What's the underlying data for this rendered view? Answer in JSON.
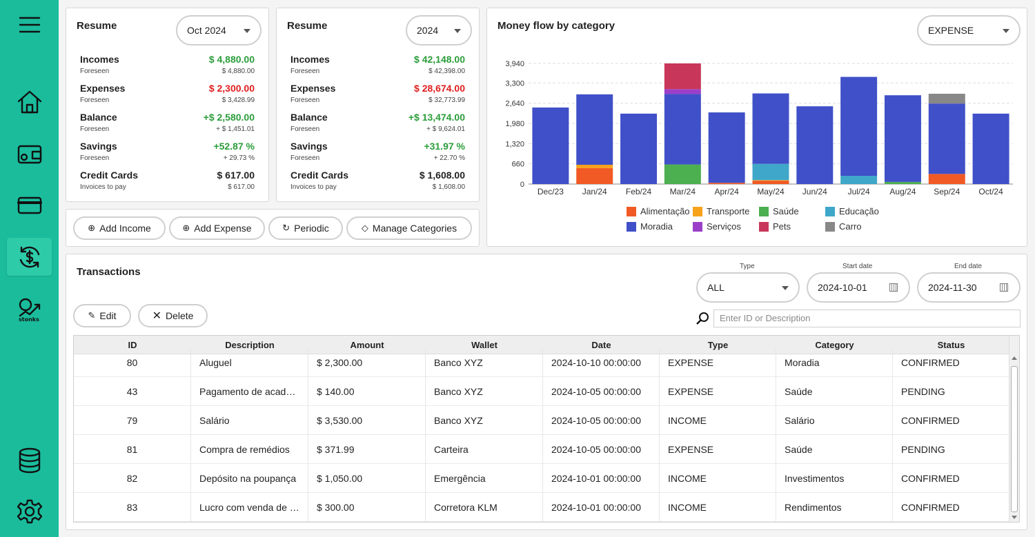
{
  "sidebar": {
    "items": [
      {
        "icon": "menu-icon"
      },
      {
        "icon": "home-icon"
      },
      {
        "icon": "wallet-icon"
      },
      {
        "icon": "credit-card-icon"
      },
      {
        "icon": "money-flow-icon"
      },
      {
        "icon": "stonks-icon",
        "label": "stonks"
      },
      {
        "icon": "database-icon"
      },
      {
        "icon": "gear-icon"
      }
    ],
    "active": "money-flow-icon"
  },
  "resume_month": {
    "title": "Resume",
    "selector": "Oct 2024",
    "rows": [
      {
        "label": "Incomes",
        "value": "$ 4,880.00",
        "sub_label": "Foreseen",
        "sub_value": "$ 4,880.00",
        "color": "green"
      },
      {
        "label": "Expenses",
        "value": "$ 2,300.00",
        "sub_label": "Foreseen",
        "sub_value": "$ 3,428.99",
        "color": "red"
      },
      {
        "label": "Balance",
        "value": "+$ 2,580.00",
        "sub_label": "Foreseen",
        "sub_value": "+ $ 1,451.01",
        "color": "green"
      },
      {
        "label": "Savings",
        "value": "+52.87 %",
        "sub_label": "Foreseen",
        "sub_value": "+ 29.73 %",
        "color": "green"
      },
      {
        "label": "Credit Cards",
        "value": "$ 617.00",
        "sub_label": "Invoices to pay",
        "sub_value": "$ 617.00",
        "color": "dark"
      }
    ]
  },
  "resume_year": {
    "title": "Resume",
    "selector": "2024",
    "rows": [
      {
        "label": "Incomes",
        "value": "$ 42,148.00",
        "sub_label": "Foreseen",
        "sub_value": "$ 42,398.00",
        "color": "green"
      },
      {
        "label": "Expenses",
        "value": "$ 28,674.00",
        "sub_label": "Foreseen",
        "sub_value": "$ 32,773.99",
        "color": "red"
      },
      {
        "label": "Balance",
        "value": "+$ 13,474.00",
        "sub_label": "Foreseen",
        "sub_value": "+ $ 9,624.01",
        "color": "green"
      },
      {
        "label": "Savings",
        "value": "+31.97 %",
        "sub_label": "Foreseen",
        "sub_value": "+ 22.70 %",
        "color": "green"
      },
      {
        "label": "Credit Cards",
        "value": "$ 1,608.00",
        "sub_label": "Invoices to pay",
        "sub_value": "$ 1,608.00",
        "color": "dark"
      }
    ]
  },
  "actions": {
    "add_income": "Add Income",
    "add_expense": "Add Expense",
    "periodic": "Periodic",
    "manage_categories": "Manage Categories"
  },
  "money_flow": {
    "title": "Money flow by category",
    "selector": "EXPENSE"
  },
  "chart_data": {
    "type": "bar",
    "stacked": true,
    "title": "Money flow by category",
    "categories": [
      "Dec/23",
      "Jan/24",
      "Feb/24",
      "Mar/24",
      "Apr/24",
      "May/24",
      "Jun/24",
      "Jul/24",
      "Aug/24",
      "Sep/24",
      "Oct/24"
    ],
    "yticks": [
      "0",
      "660",
      "1,320",
      "1,980",
      "2,640",
      "3,300",
      "3,940"
    ],
    "ylim": [
      0,
      3940
    ],
    "grid": true,
    "legend_position": "bottom",
    "series": [
      {
        "name": "Alimentação",
        "color": "#f15a24",
        "values": [
          0,
          520,
          0,
          0,
          40,
          110,
          0,
          0,
          0,
          330,
          0
        ]
      },
      {
        "name": "Transporte",
        "color": "#f7a21b",
        "values": [
          0,
          110,
          0,
          0,
          0,
          20,
          0,
          0,
          0,
          0,
          0
        ]
      },
      {
        "name": "Saúde",
        "color": "#4caf50",
        "values": [
          0,
          0,
          0,
          640,
          0,
          0,
          0,
          0,
          70,
          0,
          0
        ]
      },
      {
        "name": "Educação",
        "color": "#3fa7c9",
        "values": [
          0,
          0,
          0,
          0,
          0,
          530,
          0,
          270,
          0,
          0,
          0
        ]
      },
      {
        "name": "Moradia",
        "color": "#4050c8",
        "values": [
          2500,
          2300,
          2300,
          2300,
          2300,
          2300,
          2540,
          3230,
          2830,
          2300,
          2300
        ]
      },
      {
        "name": "Serviços",
        "color": "#9b3fc9",
        "values": [
          0,
          0,
          0,
          160,
          0,
          0,
          0,
          0,
          0,
          0,
          0
        ]
      },
      {
        "name": "Pets",
        "color": "#c8375a",
        "values": [
          0,
          0,
          0,
          840,
          0,
          0,
          0,
          0,
          0,
          0,
          0
        ]
      },
      {
        "name": "Carro",
        "color": "#888888",
        "values": [
          0,
          0,
          0,
          0,
          0,
          0,
          0,
          0,
          0,
          320,
          0
        ]
      }
    ]
  },
  "transactions": {
    "title": "Transactions",
    "type_label": "Type",
    "type_value": "ALL",
    "start_label": "Start date",
    "start_value": "2024-10-01",
    "end_label": "End date",
    "end_value": "2024-11-30",
    "edit": "Edit",
    "delete": "Delete",
    "search_placeholder": "Enter ID or Description",
    "columns": [
      "ID",
      "Description",
      "Amount",
      "Wallet",
      "Date",
      "Type",
      "Category",
      "Status"
    ],
    "rows": [
      [
        "80",
        "Aluguel",
        "$ 2,300.00",
        "Banco XYZ",
        "2024-10-10 00:00:00",
        "EXPENSE",
        "Moradia",
        "CONFIRMED"
      ],
      [
        "43",
        "Pagamento de academia",
        "$ 140.00",
        "Banco XYZ",
        "2024-10-05 00:00:00",
        "EXPENSE",
        "Saúde",
        "PENDING"
      ],
      [
        "79",
        "Salário",
        "$ 3,530.00",
        "Banco XYZ",
        "2024-10-05 00:00:00",
        "INCOME",
        "Salário",
        "CONFIRMED"
      ],
      [
        "81",
        "Compra de remédios",
        "$ 371.99",
        "Carteira",
        "2024-10-05 00:00:00",
        "EXPENSE",
        "Saúde",
        "PENDING"
      ],
      [
        "82",
        "Depósito na poupança",
        "$ 1,050.00",
        "Emergência",
        "2024-10-01 00:00:00",
        "INCOME",
        "Investimentos",
        "CONFIRMED"
      ],
      [
        "83",
        "Lucro com venda de ações",
        "$ 300.00",
        "Corretora KLM",
        "2024-10-01 00:00:00",
        "INCOME",
        "Rendimentos",
        "CONFIRMED"
      ]
    ]
  }
}
